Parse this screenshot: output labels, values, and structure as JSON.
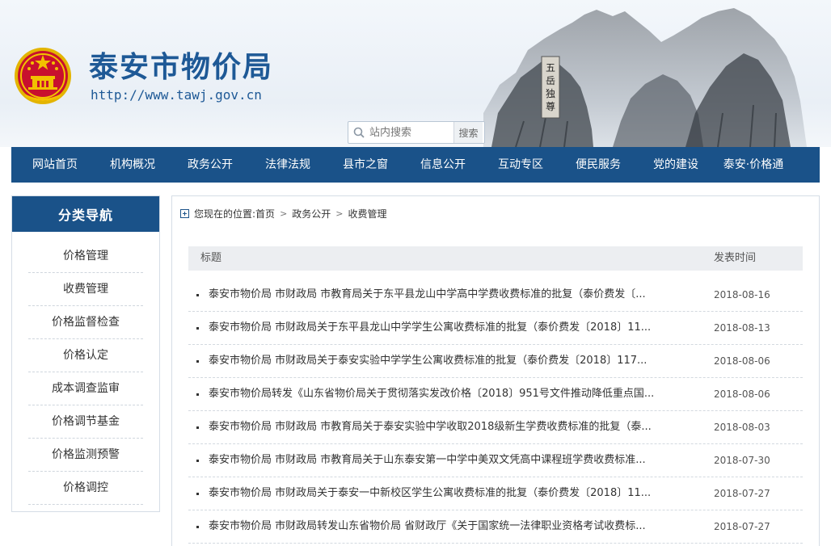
{
  "header": {
    "site_title": "泰安市物价局",
    "site_url": "http://www.tawj.gov.cn",
    "emblem_icon": "national-emblem-icon",
    "mountain_image": "mount-tai-painting",
    "rock_inscription": "五岳独尊",
    "search": {
      "placeholder": "站内搜索",
      "button_label": "搜索"
    }
  },
  "nav": {
    "items": [
      {
        "label": "网站首页"
      },
      {
        "label": "机构概况"
      },
      {
        "label": "政务公开"
      },
      {
        "label": "法律法规"
      },
      {
        "label": "县市之窗"
      },
      {
        "label": "信息公开"
      },
      {
        "label": "互动专区"
      },
      {
        "label": "便民服务"
      },
      {
        "label": "党的建设"
      },
      {
        "label": "泰安·价格通"
      }
    ]
  },
  "sidebar": {
    "title": "分类导航",
    "items": [
      {
        "label": "价格管理"
      },
      {
        "label": "收费管理"
      },
      {
        "label": "价格监督检查"
      },
      {
        "label": "价格认定"
      },
      {
        "label": "成本调查监审"
      },
      {
        "label": "价格调节基金"
      },
      {
        "label": "价格监测预警"
      },
      {
        "label": "价格调控"
      }
    ]
  },
  "breadcrumb": {
    "prefix": "您现在的位置:",
    "items": [
      {
        "label": "首页"
      },
      {
        "label": "政务公开"
      },
      {
        "label": "收费管理"
      }
    ]
  },
  "list": {
    "headers": {
      "title": "标题",
      "date": "发表时间"
    },
    "rows": [
      {
        "title": "泰安市物价局 市财政局 市教育局关于东平县龙山中学高中学费收费标准的批复（泰价费发〔...",
        "date": "2018-08-16"
      },
      {
        "title": "泰安市物价局 市财政局关于东平县龙山中学学生公寓收费标准的批复（泰价费发〔2018〕11...",
        "date": "2018-08-13"
      },
      {
        "title": "泰安市物价局 市财政局关于泰安实验中学学生公寓收费标准的批复（泰价费发〔2018〕117...",
        "date": "2018-08-06"
      },
      {
        "title": "泰安市物价局转发《山东省物价局关于贯彻落实发改价格〔2018〕951号文件推动降低重点国...",
        "date": "2018-08-06"
      },
      {
        "title": "泰安市物价局 市财政局 市教育局关于泰安实验中学收取2018级新生学费收费标准的批复（泰...",
        "date": "2018-08-03"
      },
      {
        "title": "泰安市物价局 市财政局 市教育局关于山东泰安第一中学中美双文凭高中课程班学费收费标准...",
        "date": "2018-07-30"
      },
      {
        "title": "泰安市物价局 市财政局关于泰安一中新校区学生公寓收费标准的批复（泰价费发〔2018〕11...",
        "date": "2018-07-27"
      },
      {
        "title": "泰安市物价局 市财政局转发山东省物价局 省财政厅《关于国家统一法律职业资格考试收费标...",
        "date": "2018-07-27"
      }
    ]
  },
  "colors": {
    "brand_blue": "#1a5289",
    "title_blue": "#1e5996",
    "emblem_red": "#c8102e",
    "emblem_gold": "#f2c200"
  }
}
